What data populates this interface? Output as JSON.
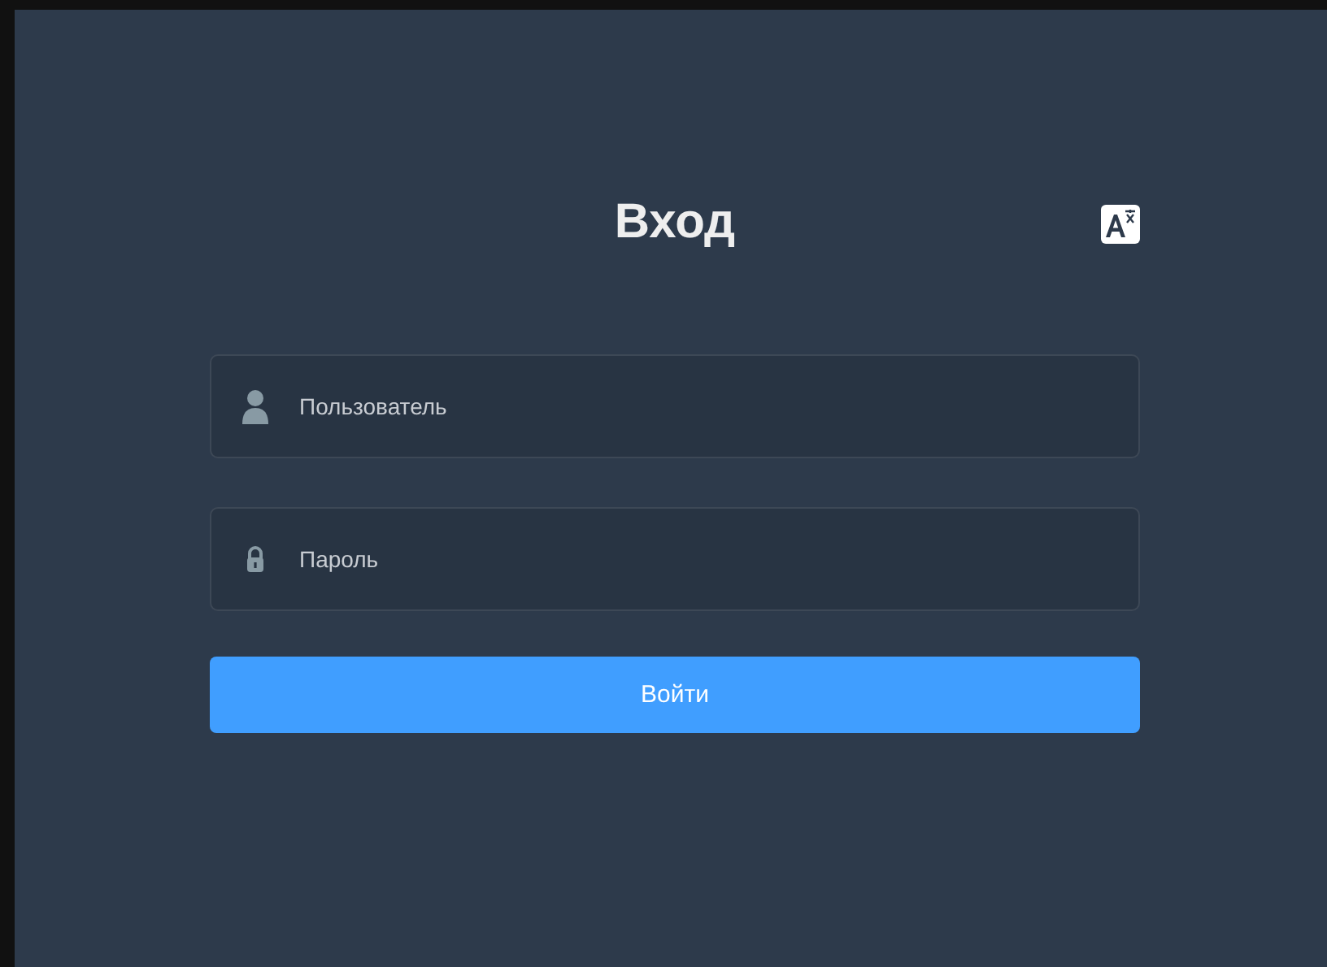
{
  "login": {
    "title": "Вход",
    "fields": [
      {
        "kind": "user",
        "placeholder": "Пользователь"
      },
      {
        "kind": "password",
        "placeholder": "Пароль"
      }
    ],
    "submit": "Войти"
  }
}
